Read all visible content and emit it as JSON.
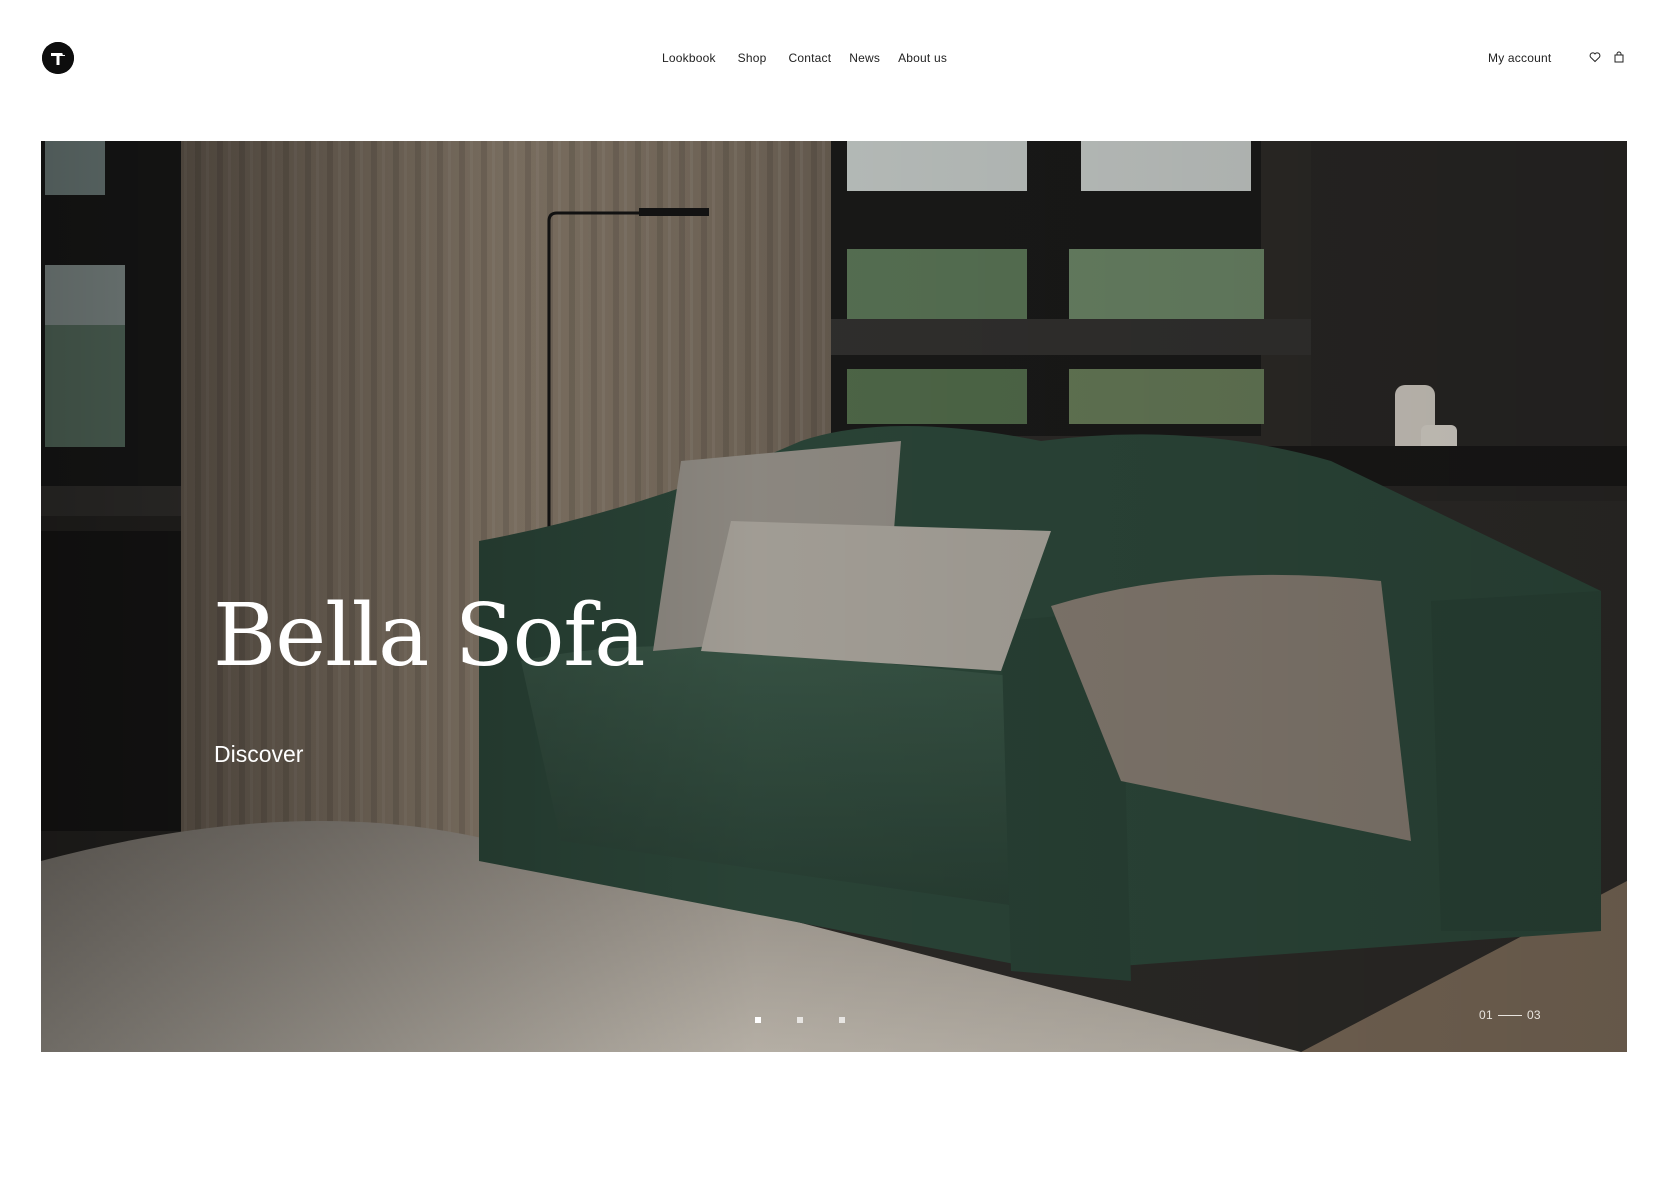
{
  "header": {
    "logo_label": "T",
    "nav": [
      "Lookbook",
      "Shop",
      "Contact",
      "News",
      "About us"
    ],
    "account_label": "My account",
    "icons": [
      "heart-icon",
      "bag-icon"
    ]
  },
  "hero": {
    "title": "Bella Sofa",
    "cta_label": "Discover",
    "slides_total": 3,
    "active_slide": 1,
    "counter_current": "01",
    "counter_total": "03"
  },
  "colors": {
    "background": "#ffffff",
    "text": "#111111",
    "hero_text": "#ffffff",
    "sofa_green": "#2f4a3c",
    "curtain": "#8f8170"
  }
}
